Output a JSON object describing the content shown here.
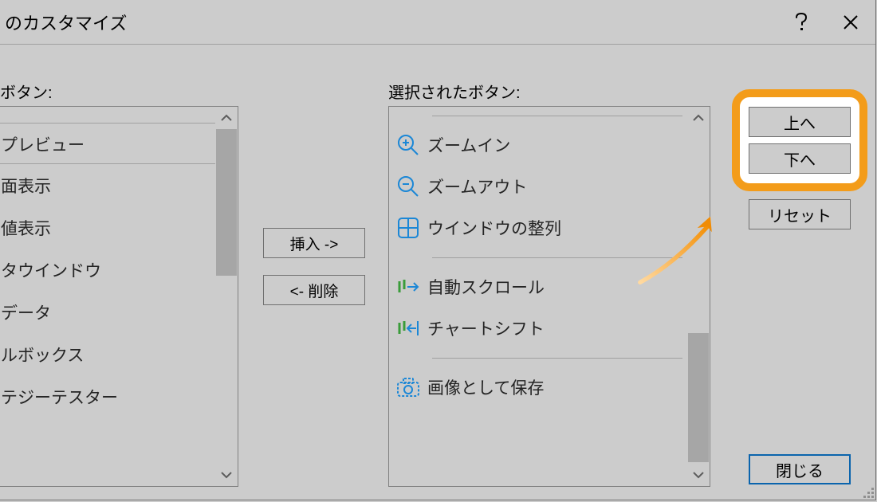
{
  "title": "のカスタマイズ",
  "labels": {
    "available": "ボタン:",
    "selected": "選択されたボタン:"
  },
  "available_items": [
    "プレビュー",
    "面表示",
    "値表示",
    "タウインドウ",
    "データ",
    "ルボックス",
    "テジーテスター"
  ],
  "selected_items": {
    "zoom_in": "ズームイン",
    "zoom_out": "ズームアウト",
    "tile": "ウインドウの整列",
    "auto_scroll": "自動スクロール",
    "chart_shift": "チャートシフト",
    "save_image": "画像として保存"
  },
  "buttons": {
    "insert": "挿入 ->",
    "remove": "<- 削除",
    "up": "上へ",
    "down": "下へ",
    "reset": "リセット",
    "close": "閉じる"
  }
}
